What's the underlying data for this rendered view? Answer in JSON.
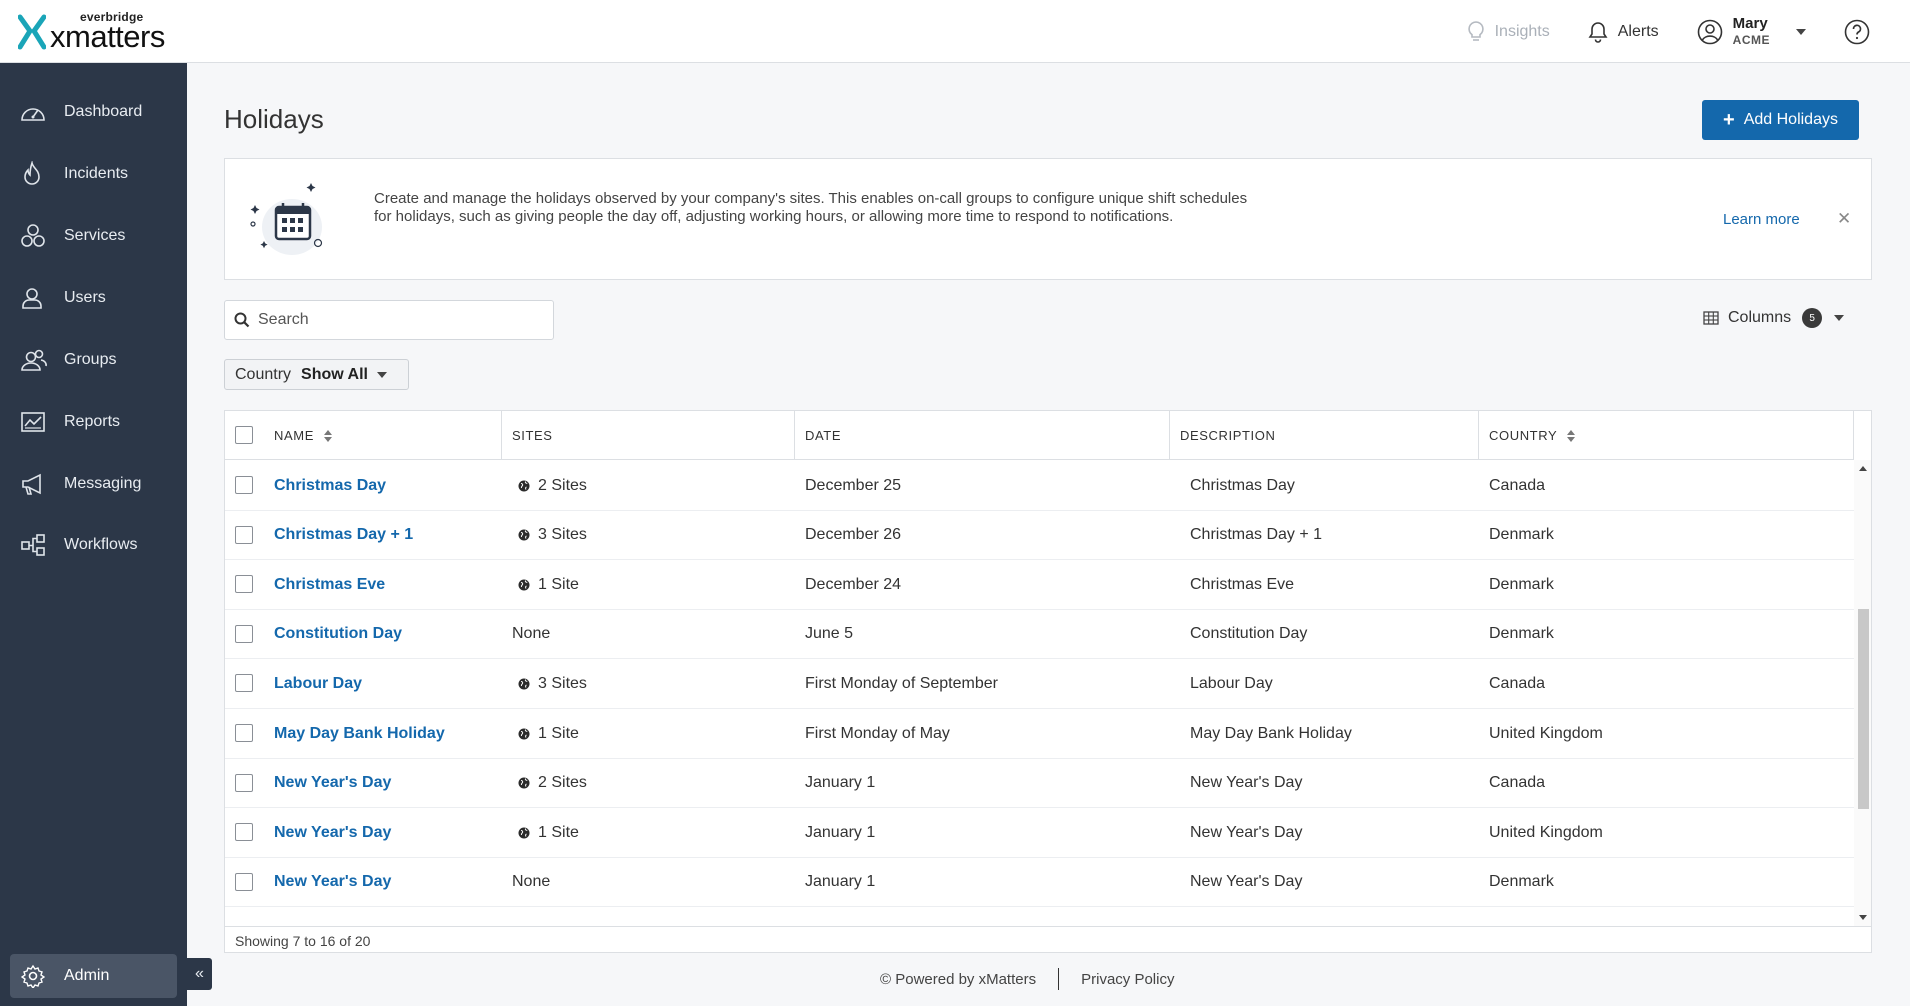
{
  "brand": {
    "parent": "everbridge",
    "product": "xmatters",
    "accent": "#1aa5b8"
  },
  "header": {
    "insights": "Insights",
    "alerts": "Alerts",
    "user_name": "Mary",
    "user_org": "ACME"
  },
  "sidebar": {
    "items": [
      {
        "label": "Dashboard",
        "icon": "dashboard-icon"
      },
      {
        "label": "Incidents",
        "icon": "flame-icon"
      },
      {
        "label": "Services",
        "icon": "services-icon"
      },
      {
        "label": "Users",
        "icon": "user-icon"
      },
      {
        "label": "Groups",
        "icon": "groups-icon"
      },
      {
        "label": "Reports",
        "icon": "reports-icon"
      },
      {
        "label": "Messaging",
        "icon": "megaphone-icon"
      },
      {
        "label": "Workflows",
        "icon": "workflow-icon"
      }
    ],
    "admin": "Admin"
  },
  "page": {
    "title": "Holidays",
    "add_button": "Add Holidays",
    "banner_text": "Create and manage the holidays observed by your company's sites. This enables on-call groups to configure unique shift schedules for holidays, such as giving people the day off, adjusting working hours, or allowing more time to respond to notifications.",
    "learn_more": "Learn more",
    "search_placeholder": "Search",
    "columns_label": "Columns",
    "columns_count": "5",
    "filter_label": "Country",
    "filter_value": "Show All"
  },
  "table": {
    "headers": {
      "name": "NAME",
      "sites": "SITES",
      "date": "DATE",
      "description": "DESCRIPTION",
      "country": "COUNTRY"
    },
    "rows": [
      {
        "name": "Christmas Day",
        "sites": "2 Sites",
        "has_globe": true,
        "date": "December 25",
        "description": "Christmas Day",
        "country": "Canada"
      },
      {
        "name": "Christmas Day + 1",
        "sites": "3 Sites",
        "has_globe": true,
        "date": "December 26",
        "description": "Christmas Day + 1",
        "country": "Denmark"
      },
      {
        "name": "Christmas Eve",
        "sites": "1 Site",
        "has_globe": true,
        "date": "December 24",
        "description": "Christmas Eve",
        "country": "Denmark"
      },
      {
        "name": "Constitution Day",
        "sites": "None",
        "has_globe": false,
        "date": "June 5",
        "description": "Constitution Day",
        "country": "Denmark"
      },
      {
        "name": "Labour Day",
        "sites": "3 Sites",
        "has_globe": true,
        "date": "First Monday of September",
        "description": "Labour Day",
        "country": "Canada"
      },
      {
        "name": "May Day Bank Holiday",
        "sites": "1 Site",
        "has_globe": true,
        "date": "First Monday of May",
        "description": "May Day Bank Holiday",
        "country": "United Kingdom"
      },
      {
        "name": "New Year's Day",
        "sites": "2 Sites",
        "has_globe": true,
        "date": "January 1",
        "description": "New Year's Day",
        "country": "Canada"
      },
      {
        "name": "New Year's Day",
        "sites": "1 Site",
        "has_globe": true,
        "date": "January 1",
        "description": "New Year's Day",
        "country": "United Kingdom"
      },
      {
        "name": "New Year's Day",
        "sites": "None",
        "has_globe": false,
        "date": "January 1",
        "description": "New Year's Day",
        "country": "Denmark"
      }
    ],
    "footer": "Showing 7 to 16 of 20"
  },
  "footer": {
    "powered": "© Powered by xMatters",
    "privacy": "Privacy Policy"
  },
  "colors": {
    "sidebar_bg": "#2c3748",
    "link": "#1468ac",
    "primary_button": "#1468ac"
  }
}
